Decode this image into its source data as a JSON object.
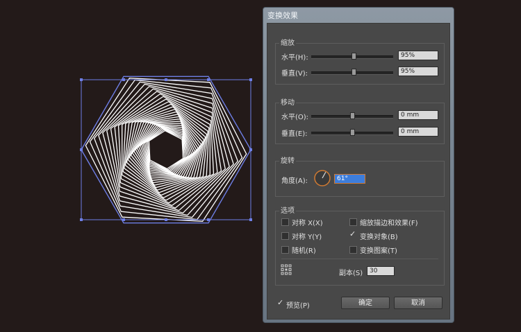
{
  "dialog": {
    "title": "变换效果",
    "scale": {
      "title": "缩放",
      "horizontal": {
        "label": "水平(H):",
        "value": "95%",
        "slider": 0.52
      },
      "vertical": {
        "label": "垂直(V):",
        "value": "95%",
        "slider": 0.52
      }
    },
    "move": {
      "title": "移动",
      "horizontal": {
        "label": "水平(O):",
        "value": "0 mm",
        "slider": 0.5
      },
      "vertical": {
        "label": "垂直(E):",
        "value": "0 mm",
        "slider": 0.5
      }
    },
    "rotate": {
      "title": "旋转",
      "angle_label": "角度(A):",
      "angle_value": "61°"
    },
    "options": {
      "title": "选项",
      "reflect_x": {
        "label": "对称 X(X)",
        "checked": false
      },
      "reflect_y": {
        "label": "对称 Y(Y)",
        "checked": false
      },
      "random": {
        "label": "随机(R)",
        "checked": false
      },
      "scale_strokes": {
        "label": "缩放描边和效果(F)",
        "checked": false
      },
      "transform_objects": {
        "label": "变换对象(B)",
        "checked": true
      },
      "transform_patterns": {
        "label": "变换图案(T)",
        "checked": false
      },
      "copies_label": "副本(S)",
      "copies_value": "30"
    },
    "preview": {
      "label": "预览(P)",
      "checked": true
    },
    "ok_label": "确定",
    "cancel_label": "取消"
  },
  "colors": {
    "canvas": "#231a19",
    "selection": "#6e7fe6",
    "stroke": "#ffffff",
    "angle_ring": "#d07a32",
    "angle_field_highlight": "#3d7ddb"
  },
  "artwork": {
    "sides": 6,
    "copies": 30,
    "scale_percent": 95,
    "rotation_deg": 61
  }
}
